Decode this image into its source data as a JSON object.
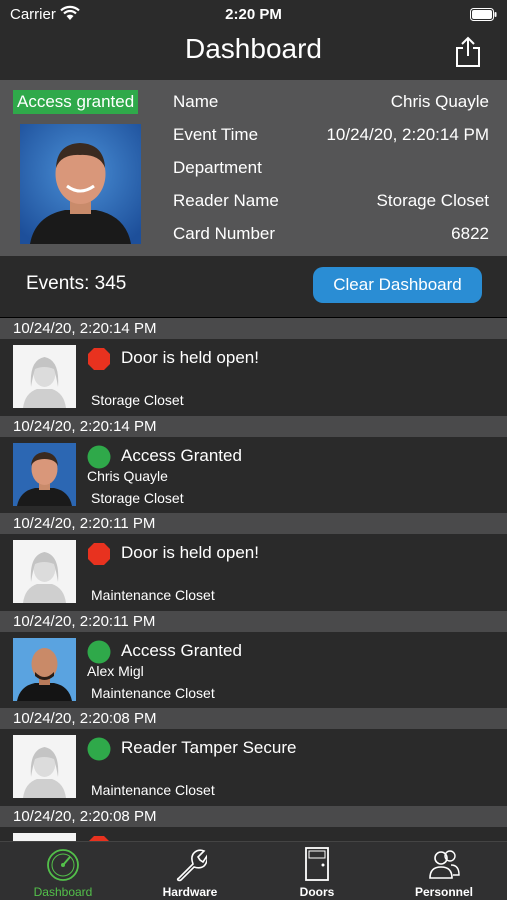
{
  "status_bar": {
    "carrier": "Carrier",
    "time": "2:20 PM"
  },
  "nav": {
    "title": "Dashboard"
  },
  "summary": {
    "badge": "Access granted",
    "badge_color": "#2fa94a",
    "fields": [
      {
        "label": "Name",
        "value": "Chris Quayle"
      },
      {
        "label": "Event Time",
        "value": "10/24/20, 2:20:14 PM"
      },
      {
        "label": "Department",
        "value": ""
      },
      {
        "label": "Reader Name",
        "value": "Storage Closet"
      },
      {
        "label": "Card Number",
        "value": "6822"
      }
    ]
  },
  "events_bar": {
    "count_label": "Events: 345",
    "clear_label": "Clear Dashboard",
    "accent": "#2a8dd4"
  },
  "events": [
    {
      "timestamp": "10/24/20, 2:20:14 PM",
      "status_icon": "alarm-icon",
      "title": "Door is held open!",
      "person": "",
      "location": "Storage Closet",
      "photo": "placeholder"
    },
    {
      "timestamp": "10/24/20, 2:20:14 PM",
      "status_icon": "granted-icon",
      "title": "Access Granted",
      "person": "Chris Quayle",
      "location": "Storage Closet",
      "photo": "chris"
    },
    {
      "timestamp": "10/24/20, 2:20:11 PM",
      "status_icon": "alarm-icon",
      "title": "Door is held open!",
      "person": "",
      "location": "Maintenance Closet",
      "photo": "placeholder"
    },
    {
      "timestamp": "10/24/20, 2:20:11 PM",
      "status_icon": "granted-icon",
      "title": "Access Granted",
      "person": "Alex Migl",
      "location": "Maintenance Closet",
      "photo": "alex"
    },
    {
      "timestamp": "10/24/20, 2:20:08 PM",
      "status_icon": "granted-icon",
      "title": "Reader Tamper Secure",
      "person": "",
      "location": "Maintenance Closet",
      "photo": "placeholder"
    },
    {
      "timestamp": "10/24/20, 2:20:08 PM",
      "status_icon": "alarm-icon",
      "title": "",
      "person": "",
      "location": "",
      "photo": "placeholder"
    }
  ],
  "tabs": [
    {
      "label": "Dashboard",
      "icon": "gauge-icon",
      "active": true
    },
    {
      "label": "Hardware",
      "icon": "wrench-icon",
      "active": false
    },
    {
      "label": "Doors",
      "icon": "door-icon",
      "active": false
    },
    {
      "label": "Personnel",
      "icon": "people-icon",
      "active": false
    }
  ],
  "colors": {
    "granted": "#2fa94a",
    "alarm": "#e8321f",
    "active_tab": "#53c04a",
    "background": "#2a2a2a",
    "header": "#4a4a4b"
  }
}
